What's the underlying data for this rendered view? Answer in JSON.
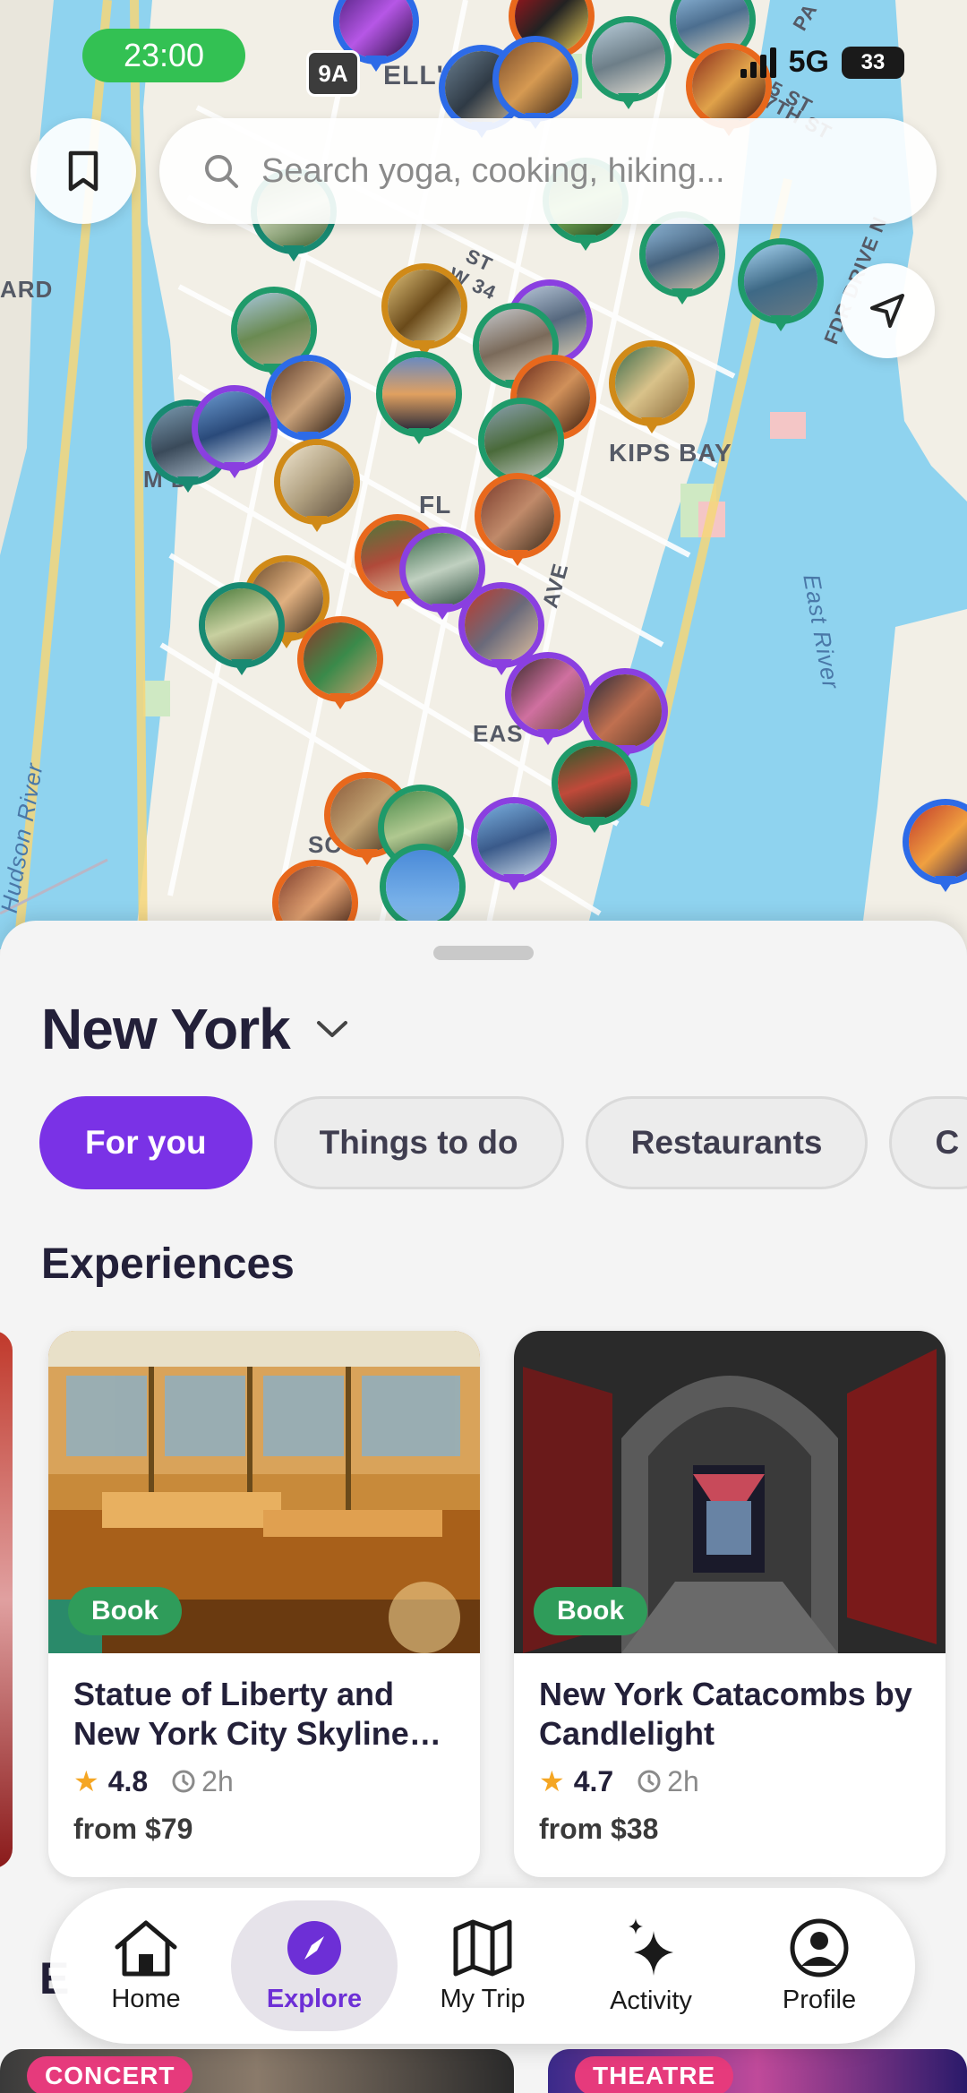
{
  "status_bar": {
    "time": "23:00",
    "route_badge": "9A",
    "network": "5G",
    "battery": "33"
  },
  "search": {
    "placeholder": "Search yoga, cooking, hiking..."
  },
  "map": {
    "labels": {
      "kips_bay": "KIPS BAY",
      "east_river": "East River",
      "hudson_river": "Hudson River",
      "fdr_drive": "FDR DRIVE N",
      "kitchen": "ELL'S KITCH",
      "ard": "ARD",
      "ave": "AVE",
      "eas": "EAS",
      "fl": "FL",
      "st": "ST",
      "w34": "W 34",
      "md": "M D",
      "so": "SC",
      "st27": "5 ST",
      "th_st": "7TH ST",
      "pa": "PA"
    }
  },
  "sheet": {
    "city": "New York",
    "chips": [
      "For you",
      "Things to do",
      "Restaurants",
      "C"
    ],
    "section_title": "Experiences",
    "cards": [
      {
        "badge": "Book",
        "title": "Statue of Liberty and New York City Skyline…",
        "rating": "4.8",
        "duration": "2h",
        "price": "from $79"
      },
      {
        "badge": "Book",
        "title": "New York Catacombs by Candlelight",
        "rating": "4.7",
        "duration": "2h",
        "price": "from $38"
      }
    ],
    "partial_heading": "E",
    "promos": [
      "CONCERT",
      "THEATRE"
    ]
  },
  "nav": {
    "items": [
      {
        "label": "Home",
        "icon": "home-icon"
      },
      {
        "label": "Explore",
        "icon": "compass-icon"
      },
      {
        "label": "My Trip",
        "icon": "map-icon"
      },
      {
        "label": "Activity",
        "icon": "sparkle-icon"
      },
      {
        "label": "Profile",
        "icon": "profile-icon"
      }
    ],
    "active_index": 1
  },
  "colors": {
    "accent": "#7a32e6",
    "book_green": "#2f9c5a",
    "time_pill": "#33c153",
    "water": "#8fd3ef",
    "promo_pink": "#e63a7c"
  }
}
